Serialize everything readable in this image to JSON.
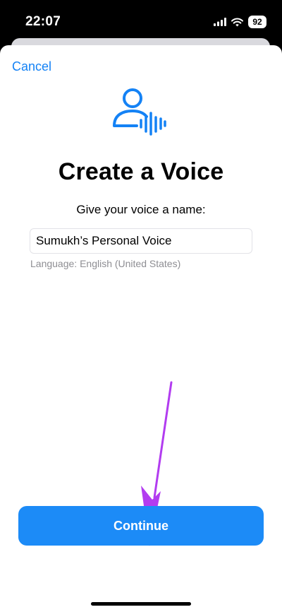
{
  "status_bar": {
    "time": "22:07",
    "battery": "92",
    "icons": [
      "cellular-signal-icon",
      "wifi-icon",
      "battery-icon"
    ]
  },
  "sheet": {
    "cancel_label": "Cancel",
    "icon": "person-voice-waveform-icon",
    "title": "Create a Voice",
    "prompt": "Give your voice a name:",
    "name_field": {
      "value": "Sumukh’s Personal Voice"
    },
    "language_label": "Language: English (United States)",
    "continue_label": "Continue"
  },
  "annotation": {
    "icon": "arrow-annotation-icon",
    "color": "#b23cf0"
  },
  "colors": {
    "accent": "#1482f5",
    "button": "#1c8bf7"
  }
}
